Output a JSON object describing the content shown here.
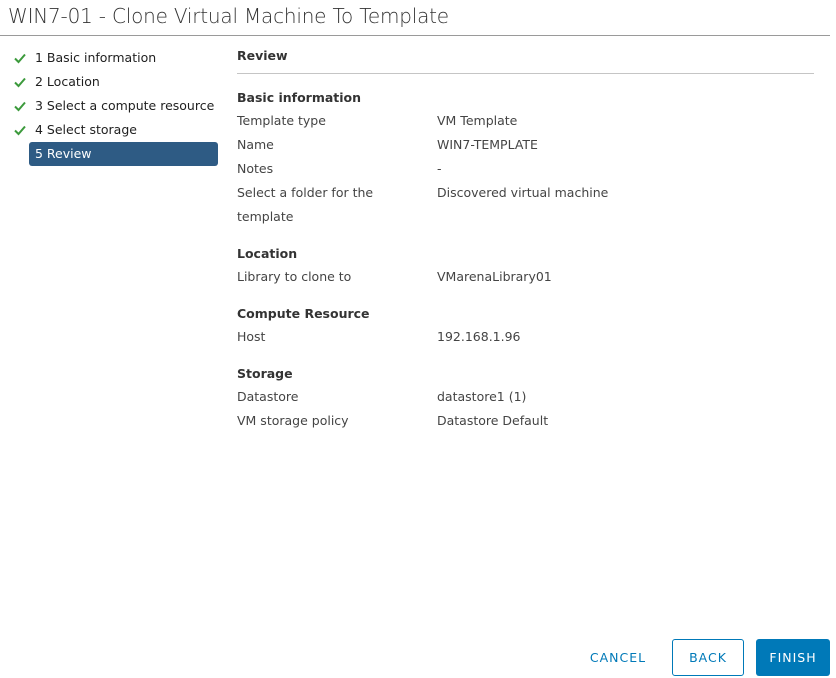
{
  "dialog": {
    "title": "WIN7-01 - Clone Virtual Machine To Template"
  },
  "steps": [
    {
      "label": "1 Basic information",
      "status": "complete"
    },
    {
      "label": "2 Location",
      "status": "complete"
    },
    {
      "label": "3 Select a compute resource",
      "status": "complete"
    },
    {
      "label": "4 Select storage",
      "status": "complete"
    },
    {
      "label": "5 Review",
      "status": "active"
    }
  ],
  "review": {
    "title": "Review",
    "basic": {
      "title": "Basic information",
      "template_type_label": "Template type",
      "template_type_value": "VM Template",
      "name_label": "Name",
      "name_value": "WIN7-TEMPLATE",
      "notes_label": "Notes",
      "notes_value": "-",
      "folder_label": "Select a folder for the template",
      "folder_value": "Discovered virtual machine"
    },
    "location": {
      "title": "Location",
      "library_label": "Library to clone to",
      "library_value": "VMarenaLibrary01"
    },
    "compute": {
      "title": "Compute Resource",
      "host_label": "Host",
      "host_value": "192.168.1.96"
    },
    "storage": {
      "title": "Storage",
      "datastore_label": "Datastore",
      "datastore_value": "datastore1 (1)",
      "policy_label": "VM storage policy",
      "policy_value": "Datastore Default"
    }
  },
  "buttons": {
    "cancel": "CANCEL",
    "back": "BACK",
    "finish": "FINISH"
  },
  "colors": {
    "accent": "#0079b8",
    "active_step": "#2e5b84",
    "check": "#3c9a3c"
  }
}
